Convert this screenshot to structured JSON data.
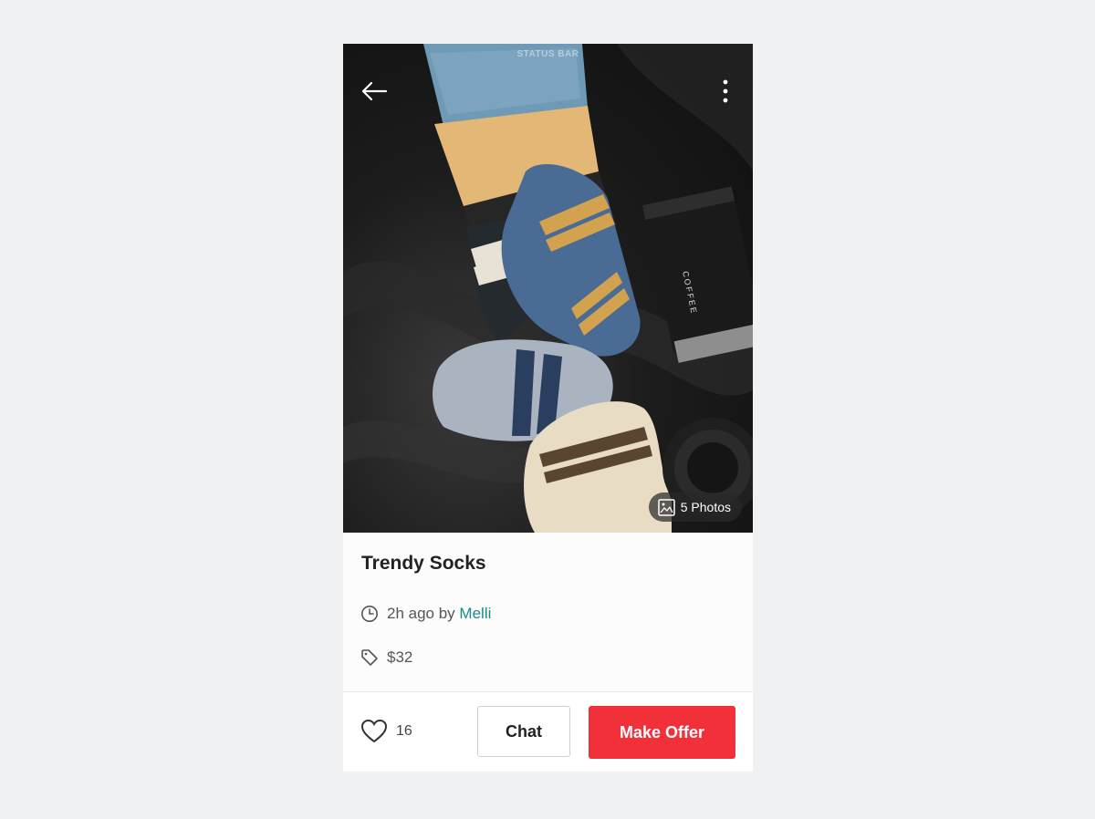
{
  "status_bar": {
    "label": "STATUS BAR"
  },
  "hero": {
    "photos_label": "5 Photos"
  },
  "product": {
    "title": "Trendy Socks",
    "time_ago": "2h ago by",
    "seller": "Melli",
    "price": "$32"
  },
  "actions": {
    "like_count": "16",
    "chat_label": "Chat",
    "offer_label": "Make Offer"
  },
  "colors": {
    "accent": "#f2303a",
    "seller_link": "#1a8a8a",
    "page_background": "#eff1f3"
  },
  "icons": [
    "back-arrow-icon",
    "more-vertical-icon",
    "image-icon",
    "clock-icon",
    "price-tag-icon",
    "heart-icon"
  ]
}
